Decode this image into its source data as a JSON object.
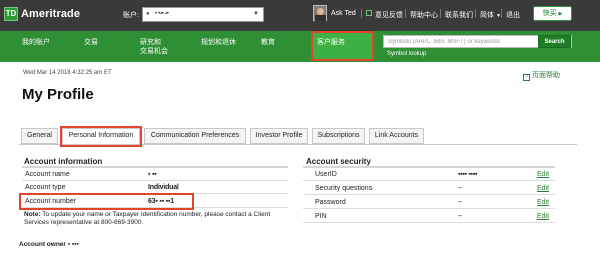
{
  "header": {
    "logo": "TD",
    "brand": "Ameritrade",
    "account_label": "账户:",
    "account_value": "• •▪• ▪•",
    "ask_ted": "Ask Ted",
    "feedback": "意见反馈",
    "help_center": "帮助中心",
    "contact": "联系我们",
    "language": "简体",
    "logout": "退出",
    "quick_trade": "快买"
  },
  "mainnav": {
    "items": [
      {
        "label": "我的账户"
      },
      {
        "label": "交易"
      },
      {
        "label": "研究和\n交易机会"
      },
      {
        "label": "规划和退休"
      },
      {
        "label": "教育"
      },
      {
        "label": "客户服务"
      }
    ],
    "search_placeholder": "Symbols (AAPL, IBM, MSFT) or keywords",
    "search_button": "Search",
    "symbol_lookup": "Symbol lookup"
  },
  "page": {
    "datetime": "Wed Mar 14 2018 4:32:25 am ET",
    "help": "页面帮助",
    "title": "My Profile"
  },
  "tabs": [
    {
      "label": "General"
    },
    {
      "label": "Personal Information"
    },
    {
      "label": "Communication Preferences"
    },
    {
      "label": "Investor Profile"
    },
    {
      "label": "Subscriptions"
    },
    {
      "label": "Link Accounts"
    }
  ],
  "account_info": {
    "title": "Account information",
    "rows": [
      {
        "label": "Account name",
        "value": "▪ ▪▪"
      },
      {
        "label": "Account type",
        "value": "Individual"
      },
      {
        "label": "Account number",
        "value": "63▪ ▪▪ ▪▪1"
      }
    ],
    "note_bold": "Note:",
    "note_text": " To update your name or Taxpayer Identification number, please contact a Client Services representative at 800-669-3900."
  },
  "account_security": {
    "title": "Account security",
    "edit_label": "Edit",
    "rows": [
      {
        "label": "UserID",
        "value": "▪▪▪▪ ▪▪▪▪"
      },
      {
        "label": "Security questions",
        "value": "--"
      },
      {
        "label": "Password",
        "value": "--"
      },
      {
        "label": "PIN",
        "value": "--"
      }
    ]
  },
  "account_owner": {
    "label": "Account owner",
    "value": " ▪ ▪▪▪"
  },
  "colors": {
    "brand_green": "#2f8f34",
    "highlight_red": "#e2452c",
    "header_dark": "#3a3a3a"
  }
}
